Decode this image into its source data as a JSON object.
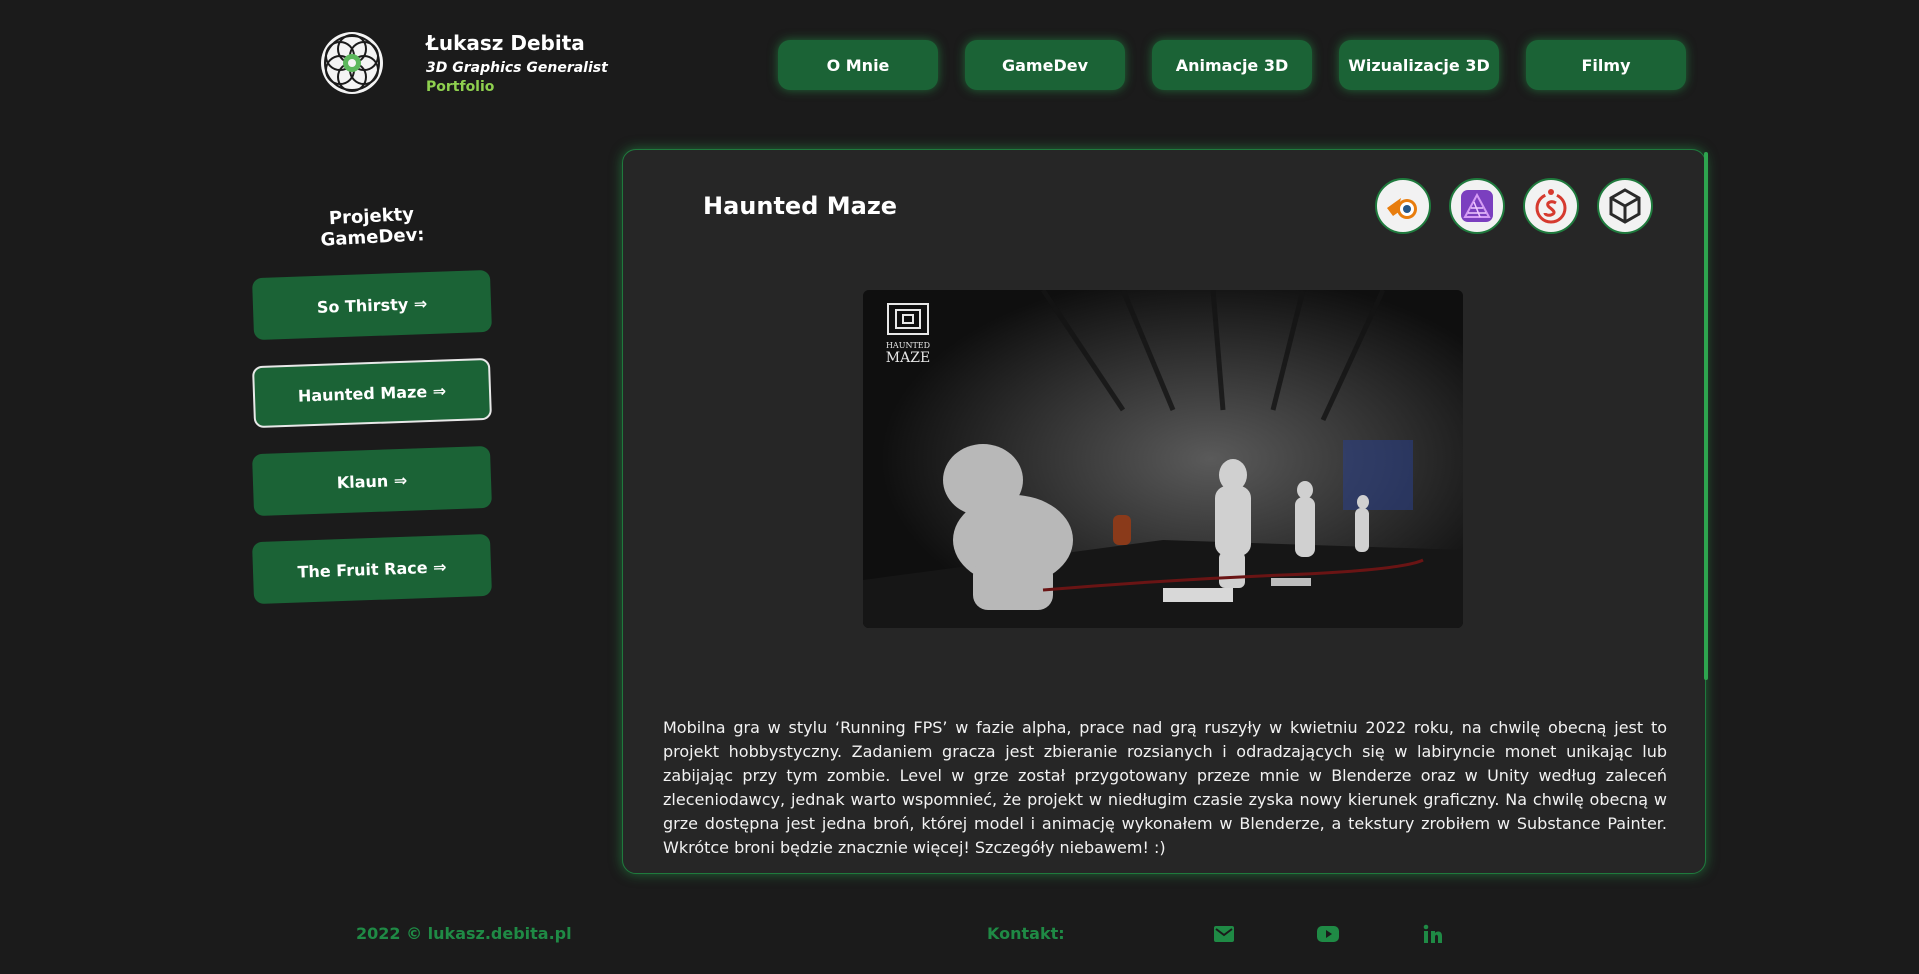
{
  "brand": {
    "name": "Łukasz Debita",
    "subtitle": "3D Graphics Generalist",
    "portfolio": "Portfolio",
    "logo_icon": "flower-of-life-logo-icon"
  },
  "nav": {
    "items": [
      {
        "label": "O Mnie"
      },
      {
        "label": "GameDev"
      },
      {
        "label": "Animacje 3D"
      },
      {
        "label": "Wizualizacje 3D"
      },
      {
        "label": "Filmy"
      }
    ]
  },
  "sidebar": {
    "title": "Projekty GameDev:",
    "items": [
      {
        "label": "So Thirsty ⇒",
        "active": false
      },
      {
        "label": "Haunted Maze ⇒",
        "active": true
      },
      {
        "label": "Klaun ⇒",
        "active": false
      },
      {
        "label": "The Fruit Race ⇒",
        "active": false
      }
    ]
  },
  "project": {
    "title": "Haunted Maze",
    "tools": [
      "blender-icon",
      "affinity-photo-icon",
      "substance-painter-icon",
      "unity-icon"
    ],
    "image_logo_text": [
      "HAUNTED",
      "MAZE"
    ],
    "description": "Mobilna gra w stylu ‘Running FPS’ w fazie alpha, prace nad grą ruszyły w kwietniu 2022 roku, na chwilę obecną jest to projekt hobbystyczny. Zadaniem gracza jest zbieranie rozsianych i odradzających się w labiryncie monet unikając lub zabijając przy tym zombie. Level w grze został przygotowany przeze mnie w Blenderze oraz w Unity według zaleceń zleceniodawcy, jednak warto wspomnieć, że projekt w niedługim czasie zyska nowy kierunek graficzny. Na chwilę obecną w grze dostępna jest jedna broń, której model i animację wykonałem w Blenderze, a tekstury zrobiłem w Substance Painter. Wkrótce broni będzie znacznie więcej! Szczegóły niebawem! :)"
  },
  "footer": {
    "copyright": "2022 © lukasz.debita.pl",
    "contact_label": "Kontakt:",
    "icons": [
      "mail-icon",
      "youtube-icon",
      "linkedin-icon"
    ]
  },
  "colors": {
    "background": "#1b1b1b",
    "panel": "#262626",
    "button_green": "#1b6336",
    "accent_green": "#1f8a45",
    "portfolio_green": "#8fd14f"
  }
}
